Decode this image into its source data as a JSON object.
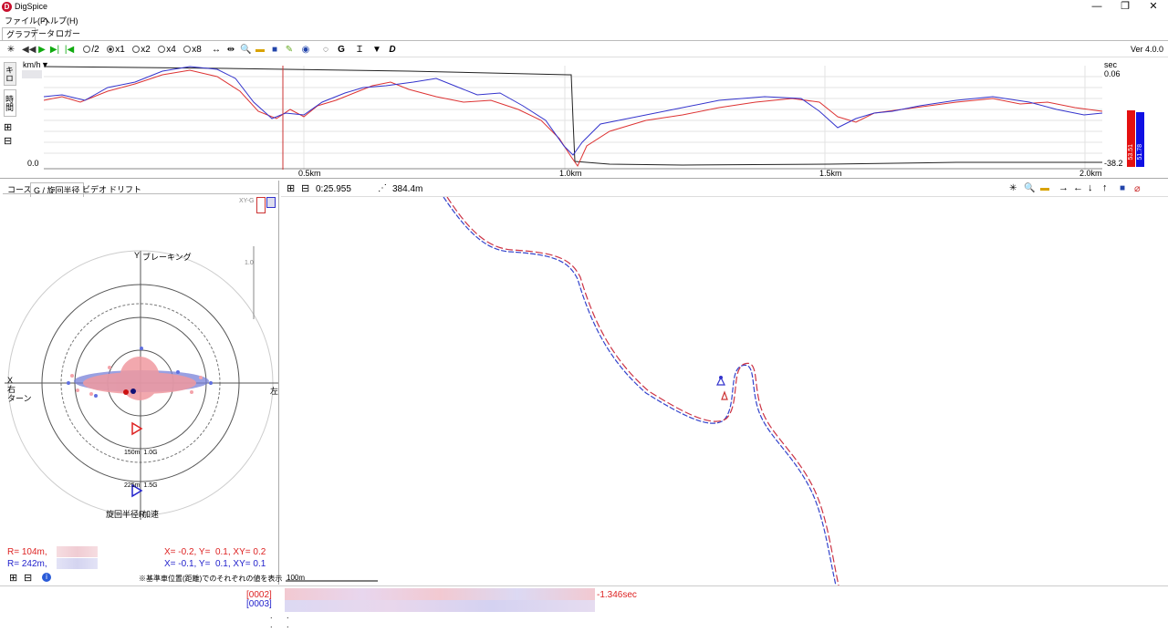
{
  "window": {
    "title": "DigSpice",
    "app_icon_letter": "D",
    "minimize": "—",
    "maximize": "❐",
    "close": "✕"
  },
  "menu": [
    "ファイル(F)",
    "ヘルプ(H)"
  ],
  "tabs": [
    "グラフ",
    "データ",
    "ロガー"
  ],
  "toolbar": {
    "speed_options": [
      "/2",
      "x1",
      "x2",
      "x4",
      "x8"
    ],
    "selected_speed": "x1",
    "version": "Ver 4.0.0"
  },
  "graph": {
    "left_unit": "km/h",
    "right_unit": "sec",
    "left_zero": "0.0",
    "right_top": "0.06",
    "right_bottom": "-38.2",
    "x_ticks": [
      "0.5km",
      "1.0km",
      "1.5km",
      "2.0km"
    ],
    "side_tabs": [
      "キロ",
      "時間"
    ],
    "bar_red_value": "53.51",
    "bar_blue_value": "51.78",
    "colors": {
      "red": "#d33",
      "blue": "#33c"
    }
  },
  "left_panel": {
    "tabs": [
      "コース",
      "G / 旋回半径",
      "ビデオ",
      "ドリフト"
    ],
    "xy_label": "XY-G",
    "scale_label": "1.0",
    "y_label": "Y",
    "braking_label": "ブレーキング",
    "x_label": "X",
    "right_turn": "右\nターン",
    "left_label": "左",
    "ring1": "150m  1.0G",
    "ring2": "225m  1.5G",
    "radius_label": "旋回半径R",
    "accel_label": "加速",
    "r_red": "R= 104m,",
    "r_blue": "R= 242m,",
    "xy_red": "X= -0.2, Y=  0.1, XY= 0.2",
    "xy_blue": "X= -0.1, Y=  0.1, XY= 0.1",
    "note": "※基準車位置(距離)でのそれぞれの値を表示"
  },
  "map": {
    "time": "0:25.955",
    "distance": "384.4m",
    "scale": "100m"
  },
  "bottom": {
    "lap_red": "[0002]",
    "lap_blue": "[0003]",
    "diff": "-1.346sec",
    "dot1": ".",
    "dot2": "."
  }
}
